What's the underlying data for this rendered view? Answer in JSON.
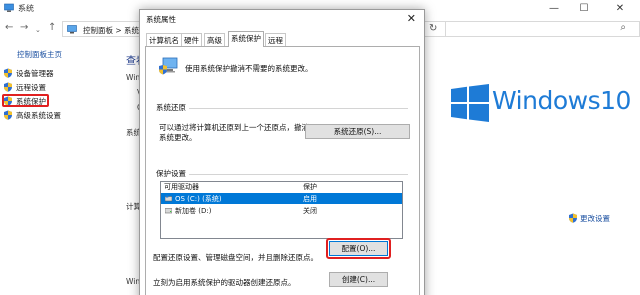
{
  "background_window": {
    "title": "系统",
    "controls": {
      "minimize": "—",
      "maximize": "☐",
      "close": "✕"
    },
    "address": {
      "path": "控制面板  >  系统和",
      "right_fragment": ""
    },
    "left_pane": {
      "home_link": "控制面板主页",
      "items": [
        {
          "label": "设备管理器"
        },
        {
          "label": "远程设置"
        },
        {
          "label": "系统保护"
        },
        {
          "label": "高级系统设置"
        }
      ]
    },
    "main": {
      "heading_fragment": "查看",
      "fragments": [
        "Win",
        "V",
        "C",
        "系统",
        "计算",
        "Win"
      ],
      "change_settings": "更改设置"
    },
    "logo_text": "Windows10"
  },
  "dialog": {
    "title": "系统属性",
    "close": "✕",
    "tabs": [
      {
        "label": "计算机名"
      },
      {
        "label": "硬件"
      },
      {
        "label": "高级"
      },
      {
        "label": "系统保护"
      },
      {
        "label": "远程"
      }
    ],
    "intro": "使用系统保护撤消不需要的系统更改。",
    "restore_group": {
      "label": "系统还原",
      "text": "可以通过将计算机还原到上一个还原点，撤消系统更改。",
      "button": "系统还原(S)..."
    },
    "protection_group": {
      "label": "保护设置",
      "columns": [
        "可用驱动器",
        "保护"
      ],
      "rows": [
        {
          "name": "OS (C:) (系统)",
          "status": "启用"
        },
        {
          "name": "新加卷 (D:)",
          "status": "关闭"
        }
      ],
      "configure_text": "配置还原设置、管理磁盘空间，并且删除还原点。",
      "configure_button": "配置(O)...",
      "create_text": "立刻为启用系统保护的驱动器创建还原点。",
      "create_button": "创建(C)..."
    }
  },
  "colors": {
    "highlight_red": "#e02020",
    "selection_blue": "#0078d7",
    "windows_blue": "#1e7bd6",
    "link_blue": "#1a4fa0"
  }
}
